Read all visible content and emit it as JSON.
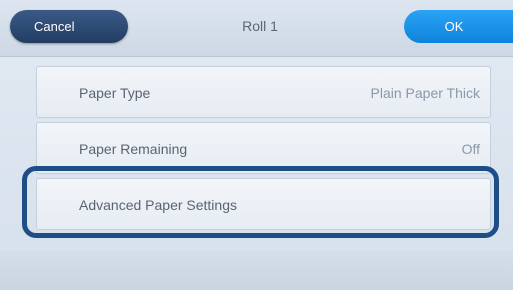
{
  "header": {
    "cancel_label": "Cancel",
    "title": "Roll 1",
    "ok_label": "OK"
  },
  "settings": {
    "items": [
      {
        "label": "Paper Type",
        "value": "Plain Paper Thick"
      },
      {
        "label": "Paper Remaining",
        "value": "Off"
      },
      {
        "label": "Advanced Paper Settings",
        "value": ""
      }
    ]
  },
  "colors": {
    "cancel_button": "#223d63",
    "ok_button": "#0e83dc",
    "highlight_frame": "#1d4f86"
  }
}
